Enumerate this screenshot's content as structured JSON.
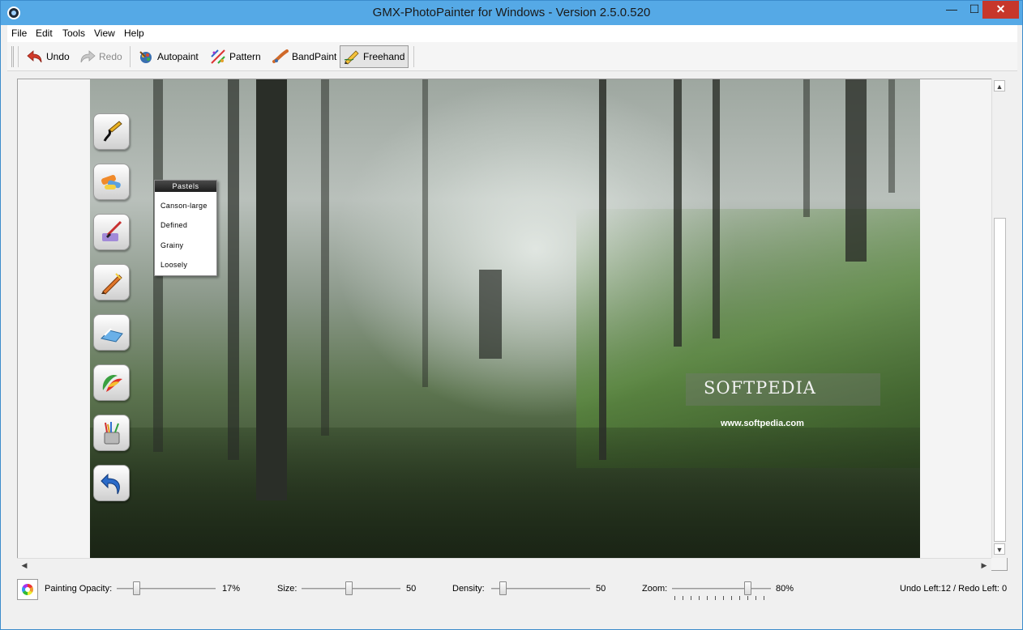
{
  "window": {
    "title": "GMX-PhotoPainter for Windows - Version 2.5.0.520",
    "minimize_glyph": "—",
    "maximize_glyph": "☐",
    "close_glyph": "✕"
  },
  "menu": [
    "File",
    "Edit",
    "Tools",
    "View",
    "Help"
  ],
  "toolbar": {
    "undo": "Undo",
    "redo": "Redo",
    "autopaint": "Autopaint",
    "pattern": "Pattern",
    "bandpaint": "BandPaint",
    "freehand": "Freehand",
    "active_tool": "Freehand"
  },
  "palette": {
    "icons": [
      "freehand-brush-icon",
      "pastels-icon",
      "paint-brush-icon",
      "crayon-icon",
      "watercolor-icon",
      "color-palette-icon",
      "brush-cup-icon",
      "undo-arrow-icon"
    ]
  },
  "pastels_popup": {
    "title": "Pastels",
    "items": [
      "Canson-large",
      "Defined",
      "Grainy",
      "Loosely"
    ]
  },
  "watermark": {
    "name": "SOFTPEDIA",
    "url": "www.softpedia.com"
  },
  "status": {
    "opacity_label": "Painting Opacity:",
    "opacity_value": "17%",
    "opacity_fraction": 0.17,
    "size_label": "Size:",
    "size_value": "50",
    "density_label": "Density:",
    "density_value": "50",
    "zoom_label": "Zoom:",
    "zoom_value": "80%",
    "undo_redo": "Undo Left:12 / Redo Left: 0"
  }
}
